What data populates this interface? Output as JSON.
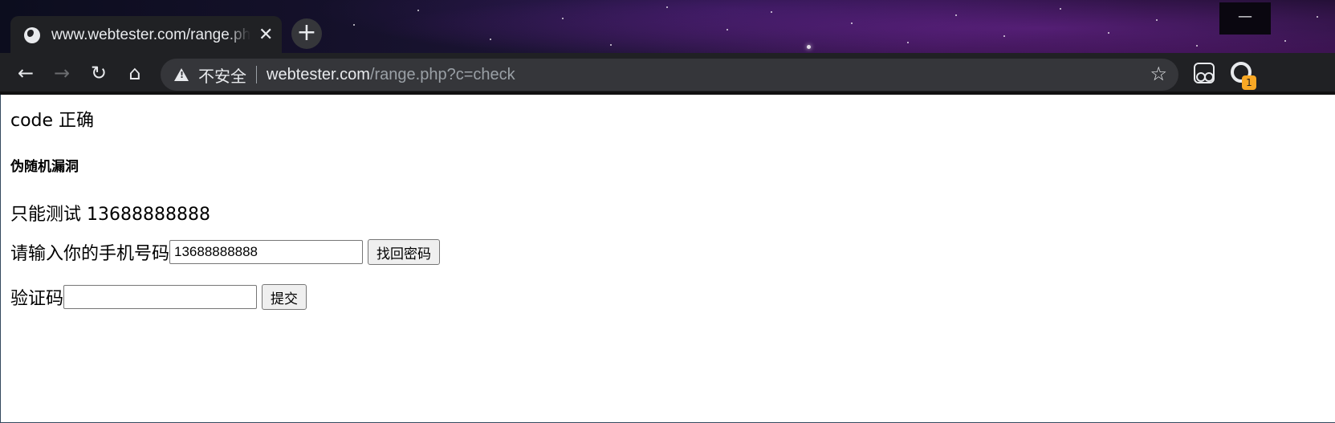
{
  "browser": {
    "tab_title": "www.webtester.com/range.php?c=check",
    "tab_close": "✕",
    "new_tab": "+",
    "minimize": "—",
    "security_label": "不安全",
    "url_host": "webtester.com",
    "url_path": "/range.php?c=check",
    "extension_badge": "1"
  },
  "page": {
    "status_message": "code 正确",
    "heading": "伪随机漏洞",
    "test_hint": "只能测试 13688888888",
    "phone_label": "请输入你的手机号码",
    "phone_value": "13688888888",
    "recover_button": "找回密码",
    "code_label": "验证码",
    "code_value": "",
    "submit_button": "提交"
  }
}
